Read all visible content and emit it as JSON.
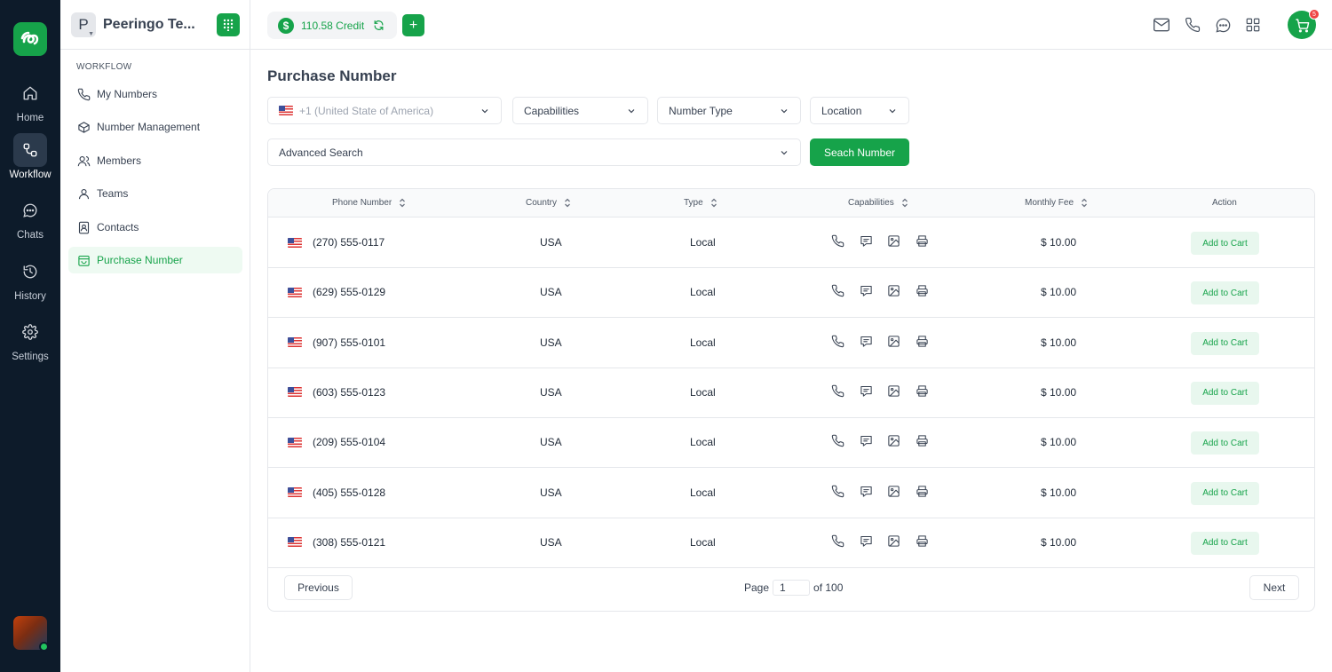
{
  "rail": {
    "items": [
      {
        "label": "Home",
        "icon": "home-icon"
      },
      {
        "label": "Workflow",
        "icon": "workflow-icon"
      },
      {
        "label": "Chats",
        "icon": "chat-icon"
      },
      {
        "label": "History",
        "icon": "history-icon"
      },
      {
        "label": "Settings",
        "icon": "gear-icon"
      }
    ],
    "active": "Workflow",
    "accent": "#16a34a",
    "background": "#0d1b2a"
  },
  "workspace": {
    "initial": "P",
    "name": "Peeringo Te..."
  },
  "sidebar": {
    "section": "WORKFLOW",
    "items": [
      {
        "label": "My Numbers",
        "icon": "phone-icon"
      },
      {
        "label": "Number Management",
        "icon": "cube-icon"
      },
      {
        "label": "Members",
        "icon": "users-icon"
      },
      {
        "label": "Teams",
        "icon": "team-icon"
      },
      {
        "label": "Contacts",
        "icon": "contact-book-icon"
      },
      {
        "label": "Purchase Number",
        "icon": "shopping-bag-icon"
      }
    ],
    "active": "Purchase Number"
  },
  "header": {
    "credit_symbol": "$",
    "credit": "110.58 Credit",
    "add_label": "+",
    "cart_count": "5",
    "icons": [
      "mail-icon",
      "phone-icon",
      "chat-icon",
      "apps-grid-icon",
      "cart-icon"
    ]
  },
  "page": {
    "title": "Purchase Number"
  },
  "filters": {
    "country_placeholder": "+1 (United State of America)",
    "capabilities": "Capabilities",
    "number_type": "Number Type",
    "location": "Location",
    "advanced": "Advanced Search",
    "search_button": "Seach Number"
  },
  "table": {
    "columns": [
      "Phone Number",
      "Country",
      "Type",
      "Capabilities",
      "Monthly Fee",
      "Action"
    ],
    "capability_icons": [
      "phone-icon",
      "sms-icon",
      "mms-icon",
      "fax-icon"
    ],
    "rows": [
      {
        "phone": "(270) 555-0117",
        "country": "USA",
        "type": "Local",
        "fee": "$ 10.00",
        "action": "Add to Cart"
      },
      {
        "phone": "(629) 555-0129",
        "country": "USA",
        "type": "Local",
        "fee": "$ 10.00",
        "action": "Add to Cart"
      },
      {
        "phone": "(907) 555-0101",
        "country": "USA",
        "type": "Local",
        "fee": "$ 10.00",
        "action": "Add to Cart"
      },
      {
        "phone": "(603) 555-0123",
        "country": "USA",
        "type": "Local",
        "fee": "$ 10.00",
        "action": "Add to Cart"
      },
      {
        "phone": "(209) 555-0104",
        "country": "USA",
        "type": "Local",
        "fee": "$ 10.00",
        "action": "Add to Cart"
      },
      {
        "phone": "(405) 555-0128",
        "country": "USA",
        "type": "Local",
        "fee": "$ 10.00",
        "action": "Add to Cart"
      },
      {
        "phone": "(308) 555-0121",
        "country": "USA",
        "type": "Local",
        "fee": "$ 10.00",
        "action": "Add to Cart"
      }
    ]
  },
  "pagination": {
    "previous": "Previous",
    "next": "Next",
    "page_label": "Page",
    "current": "1",
    "of_label": "of 100"
  }
}
